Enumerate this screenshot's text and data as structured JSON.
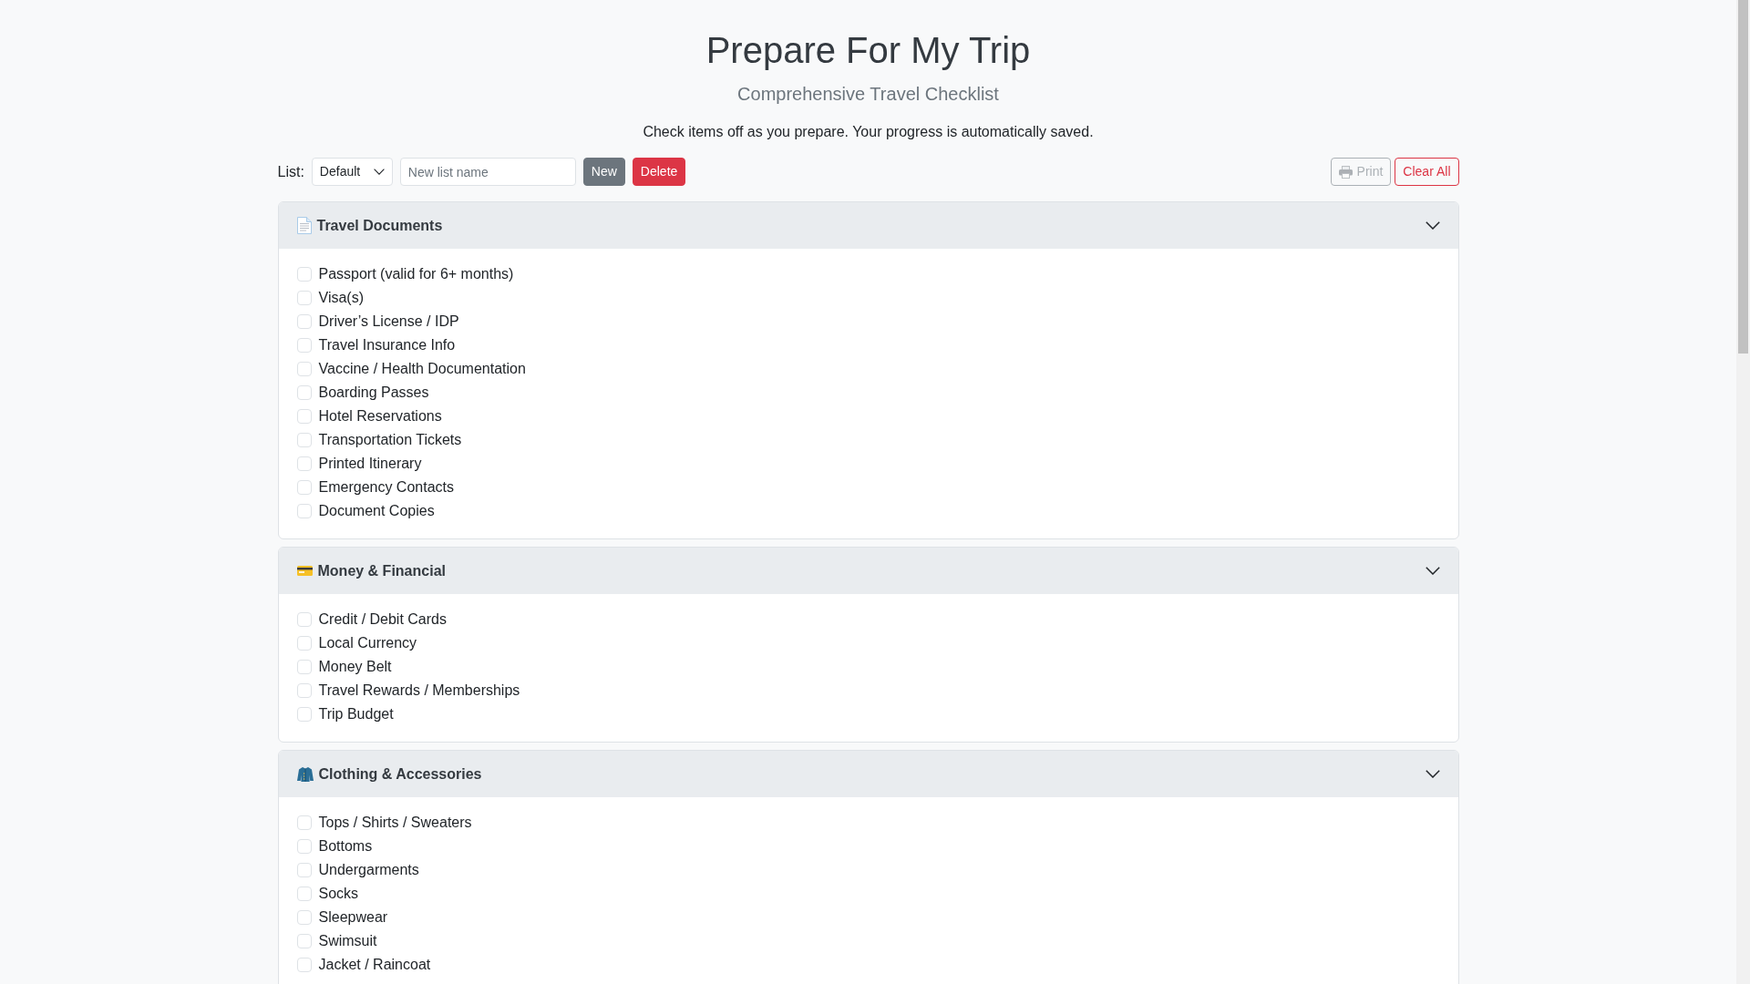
{
  "header": {
    "title": "Prepare For My Trip",
    "subtitle": "Comprehensive Travel Checklist",
    "instructions": "Check items off as you prepare. Your progress is automatically saved."
  },
  "toolbar": {
    "list_label": "List:",
    "list_select": {
      "value": "Default"
    },
    "new_list_field": {
      "placeholder": "New list name"
    },
    "new_button": {
      "label": "New"
    },
    "delete_button": {
      "label": "Delete"
    },
    "print_button": {
      "label": "Print",
      "disabled": true
    },
    "clear_button": {
      "label": "Clear All"
    }
  },
  "sections": [
    {
      "title": "Travel Documents",
      "expanded": true,
      "items": [
        {
          "label": "Passport (valid for 6+ months)",
          "checked": false
        },
        {
          "label": "Visa(s)",
          "checked": false
        },
        {
          "label": "Driver’s License / IDP",
          "checked": false
        },
        {
          "label": "Travel Insurance Info",
          "checked": false
        },
        {
          "label": "Vaccine / Health Documentation",
          "checked": false
        },
        {
          "label": "Boarding Passes",
          "checked": false
        },
        {
          "label": "Hotel Reservations",
          "checked": false
        },
        {
          "label": "Transportation Tickets",
          "checked": false
        },
        {
          "label": "Printed Itinerary",
          "checked": false
        },
        {
          "label": "Emergency Contacts",
          "checked": false
        },
        {
          "label": "Document Copies",
          "checked": false
        }
      ]
    },
    {
      "title": "Money & Financial",
      "expanded": true,
      "items": [
        {
          "label": "Credit / Debit Cards",
          "checked": false
        },
        {
          "label": "Local Currency",
          "checked": false
        },
        {
          "label": "Money Belt",
          "checked": false
        },
        {
          "label": "Travel Rewards / Memberships",
          "checked": false
        },
        {
          "label": "Trip Budget",
          "checked": false
        }
      ]
    },
    {
      "title": "Clothing & Accessories",
      "expanded": true,
      "items": [
        {
          "label": "Tops / Shirts / Sweaters",
          "checked": false
        },
        {
          "label": "Bottoms",
          "checked": false
        },
        {
          "label": "Undergarments",
          "checked": false
        },
        {
          "label": "Socks",
          "checked": false
        },
        {
          "label": "Sleepwear",
          "checked": false
        },
        {
          "label": "Swimsuit",
          "checked": false
        },
        {
          "label": "Jacket / Raincoat",
          "checked": false
        }
      ]
    }
  ]
}
